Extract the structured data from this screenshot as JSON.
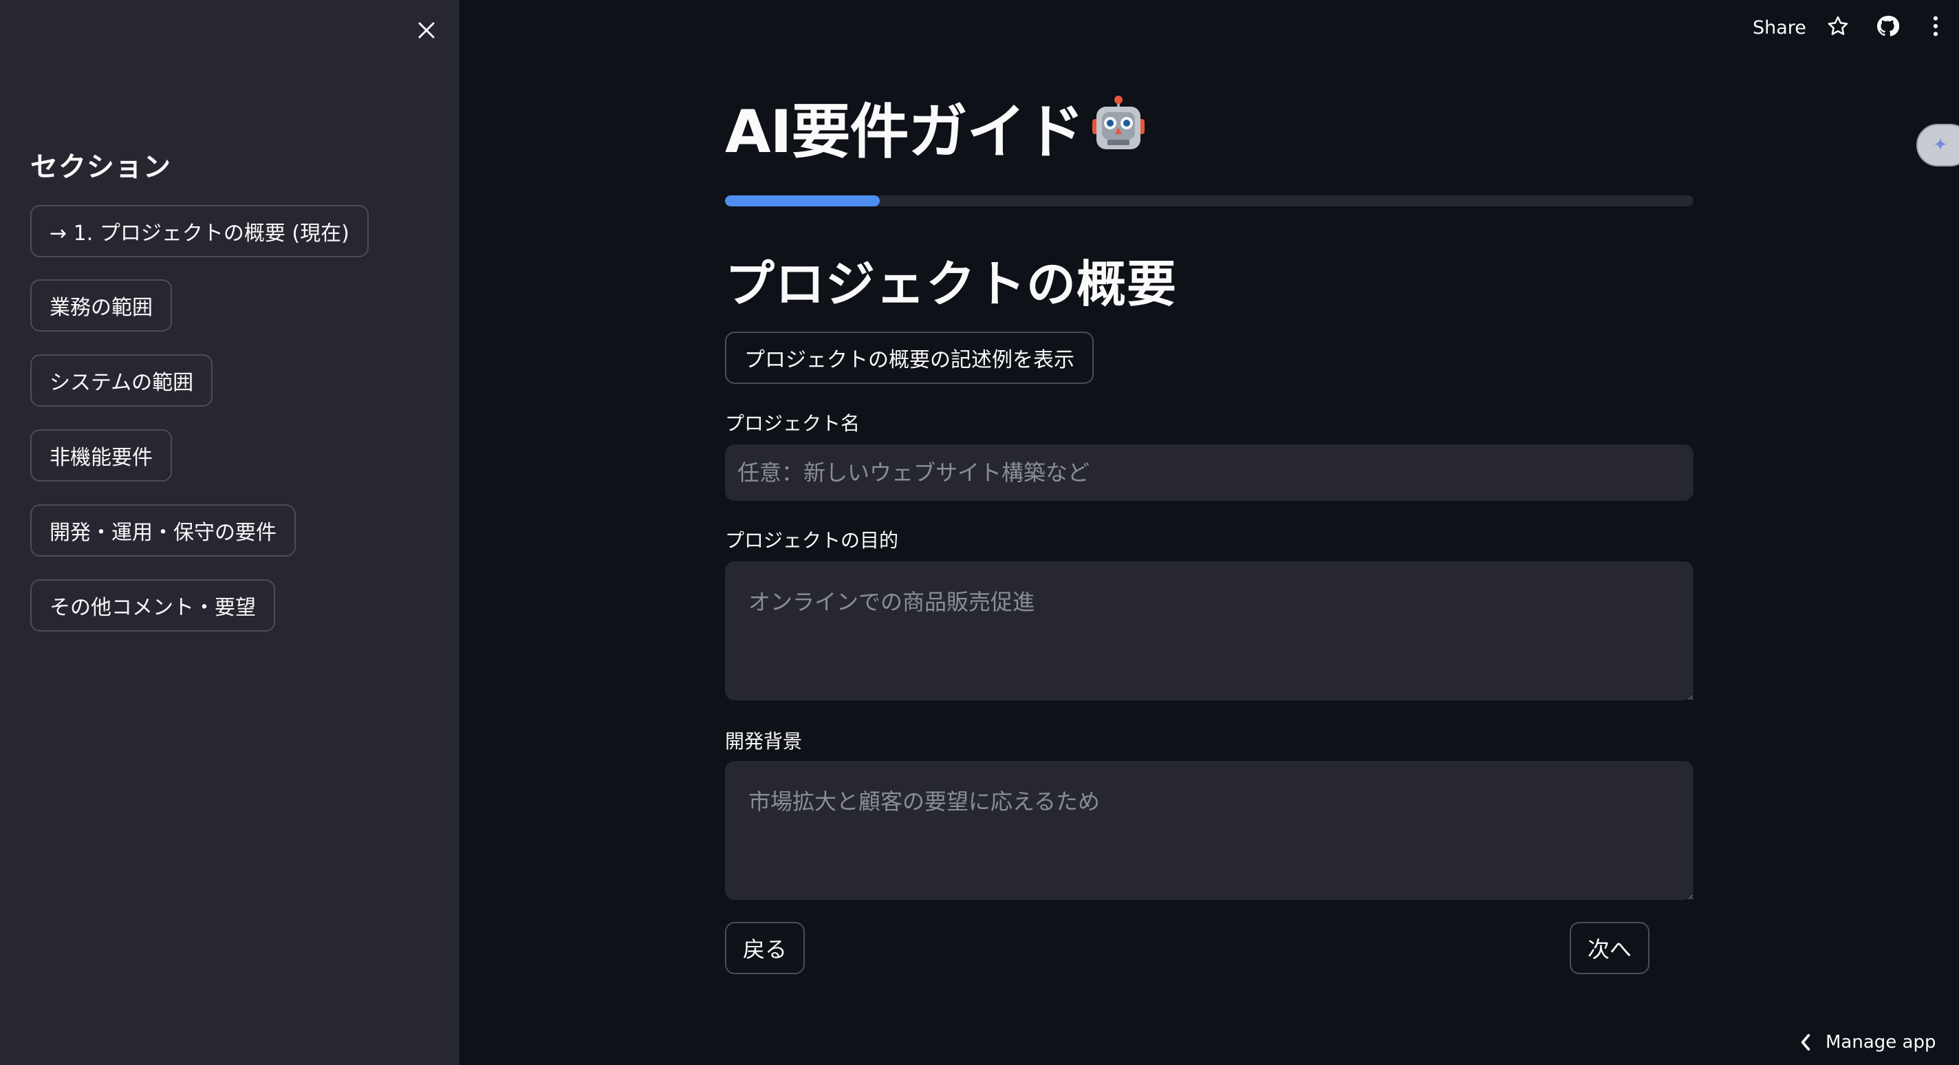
{
  "header": {
    "share_label": "Share",
    "icons": [
      "star-icon",
      "github-icon",
      "more-vertical-icon"
    ]
  },
  "sidebar": {
    "close_icon": "close-icon",
    "heading": "セクション",
    "items": [
      {
        "label": "→ 1. プロジェクトの概要 (現在)",
        "current": true
      },
      {
        "label": "業務の範囲"
      },
      {
        "label": "システムの範囲"
      },
      {
        "label": "非機能要件"
      },
      {
        "label": "開発・運用・保守の要件"
      },
      {
        "label": "その他コメント・要望"
      }
    ]
  },
  "main": {
    "title": "AI要件ガイド",
    "title_icon": "robot-icon",
    "progress_fraction": 0.16,
    "progress_color": "#4e8ef0",
    "section_title": "プロジェクトの概要",
    "example_button_label": "プロジェクトの概要の記述例を表示",
    "fields": {
      "project_name": {
        "label": "プロジェクト名",
        "placeholder": "任意：新しいウェブサイト構築など",
        "value": ""
      },
      "purpose": {
        "label": "プロジェクトの目的",
        "placeholder": "オンラインでの商品販売促進",
        "value": ""
      },
      "background": {
        "label": "開発背景",
        "placeholder": "市場拡大と顧客の要望に応えるため",
        "value": ""
      }
    },
    "back_label": "戻る",
    "next_label": "次へ"
  },
  "footer": {
    "manage_app_label": "Manage app",
    "icon": "chevron-left-icon"
  },
  "colors": {
    "background": "#0e1117",
    "sidebar": "#262730",
    "accent": "#4e8ef0",
    "text": "#fafafa"
  }
}
